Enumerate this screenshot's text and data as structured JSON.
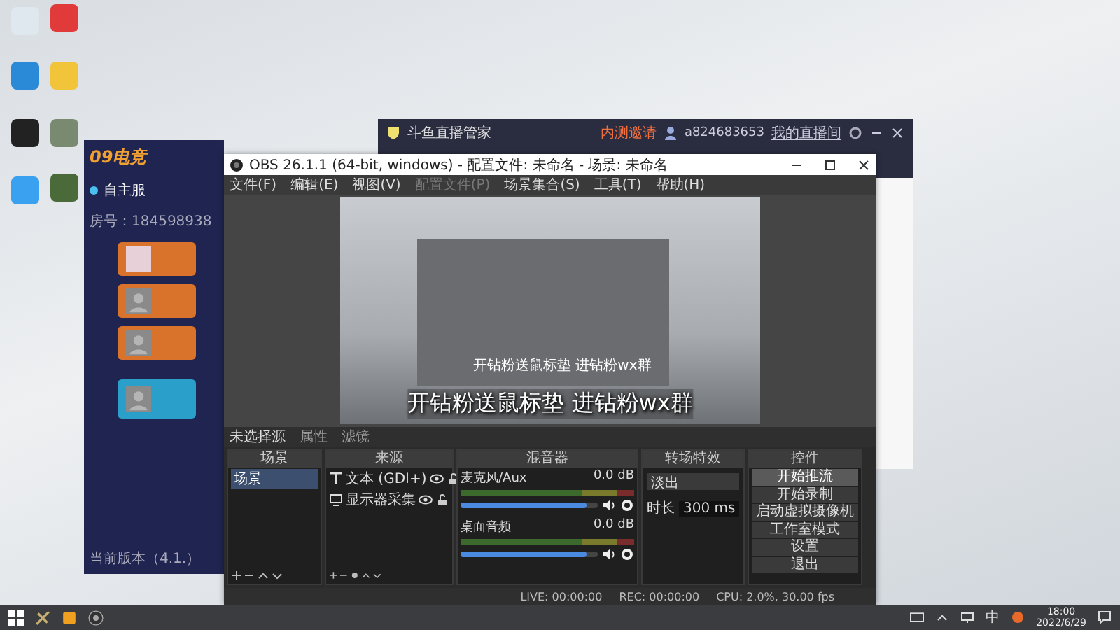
{
  "left_window": {
    "logo": "09电竞",
    "tab": "自主服",
    "room": "房号：184598938",
    "version": "当前版本（4.1.）",
    "seats": [
      {
        "kind": "photo",
        "color": "#d9722a"
      },
      {
        "kind": "empty",
        "color": "#d9722a"
      },
      {
        "kind": "empty",
        "color": "#d9722a"
      },
      {
        "kind": "empty",
        "color": "#2a9fc9"
      }
    ]
  },
  "douyu_window": {
    "title": "斗鱼直播管家",
    "invite": "内测邀请",
    "user": "a824683653",
    "my_room": "我的直播间"
  },
  "obs": {
    "title": "OBS 26.1.1 (64-bit, windows) - 配置文件: 未命名 - 场景: 未命名",
    "menu": [
      {
        "label": "文件(F)",
        "disabled": false
      },
      {
        "label": "编辑(E)",
        "disabled": false
      },
      {
        "label": "视图(V)",
        "disabled": false
      },
      {
        "label": "配置文件(P)",
        "disabled": true
      },
      {
        "label": "场景集合(S)",
        "disabled": false
      },
      {
        "label": "工具(T)",
        "disabled": false
      },
      {
        "label": "帮助(H)",
        "disabled": false
      }
    ],
    "preview": {
      "caption": "开钻粉送鼠标垫  进钻粉wx群",
      "nested_caption": "开钻粉送鼠标垫  进钻粉wx群"
    },
    "source_toolbar": {
      "status": "未选择源",
      "buttons": [
        "属性",
        "滤镜"
      ]
    },
    "scenes": {
      "title": "场景",
      "items": [
        {
          "name": "场景",
          "selected": true
        }
      ]
    },
    "sources": {
      "title": "来源",
      "items": [
        {
          "name": "文本 (GDI+)",
          "kind": "text"
        },
        {
          "name": "显示器采集",
          "kind": "display"
        }
      ]
    },
    "mixer": {
      "title": "混音器",
      "channels": [
        {
          "name": "麦克风/Aux",
          "reading": "0.0 dB",
          "level": 0.92
        },
        {
          "name": "桌面音频",
          "reading": "0.0 dB",
          "level": 0.92
        }
      ]
    },
    "transitions": {
      "title": "转场特效",
      "transition": "淡出",
      "duration_label": "时长",
      "duration": "300 ms"
    },
    "controls": {
      "title": "控件",
      "buttons": [
        {
          "label": "开始推流",
          "selected": true
        },
        {
          "label": "开始录制",
          "selected": false
        },
        {
          "label": "启动虚拟摄像机",
          "selected": false
        },
        {
          "label": "工作室模式",
          "selected": false
        },
        {
          "label": "设置",
          "selected": false
        },
        {
          "label": "退出",
          "selected": false
        }
      ]
    },
    "status_bar": {
      "live": "LIVE: 00:00:00",
      "rec": "REC: 00:00:00",
      "cpu": "CPU: 2.0%, 30.00 fps"
    }
  },
  "taskbar": {
    "ime": "中",
    "time": "18:00",
    "date": "2022/6/29"
  }
}
